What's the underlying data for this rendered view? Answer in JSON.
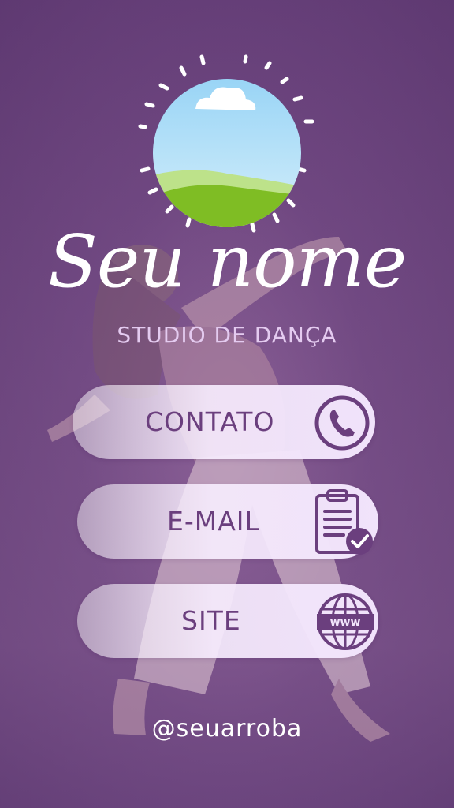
{
  "header": {
    "name": "Seu nome",
    "subtitle": "STUDIO DE DANÇA"
  },
  "buttons": [
    {
      "label": "CONTATO",
      "icon": "phone-icon"
    },
    {
      "label": "E-MAIL",
      "icon": "clipboard-check-icon"
    },
    {
      "label": "SITE",
      "icon": "globe-www-icon"
    }
  ],
  "footer": {
    "handle": "@seuarroba"
  },
  "colors": {
    "background": "#6e4680",
    "accent": "#6b3f7e",
    "button_fill": "#f1e3fb",
    "subtitle": "#e4cbf0"
  }
}
